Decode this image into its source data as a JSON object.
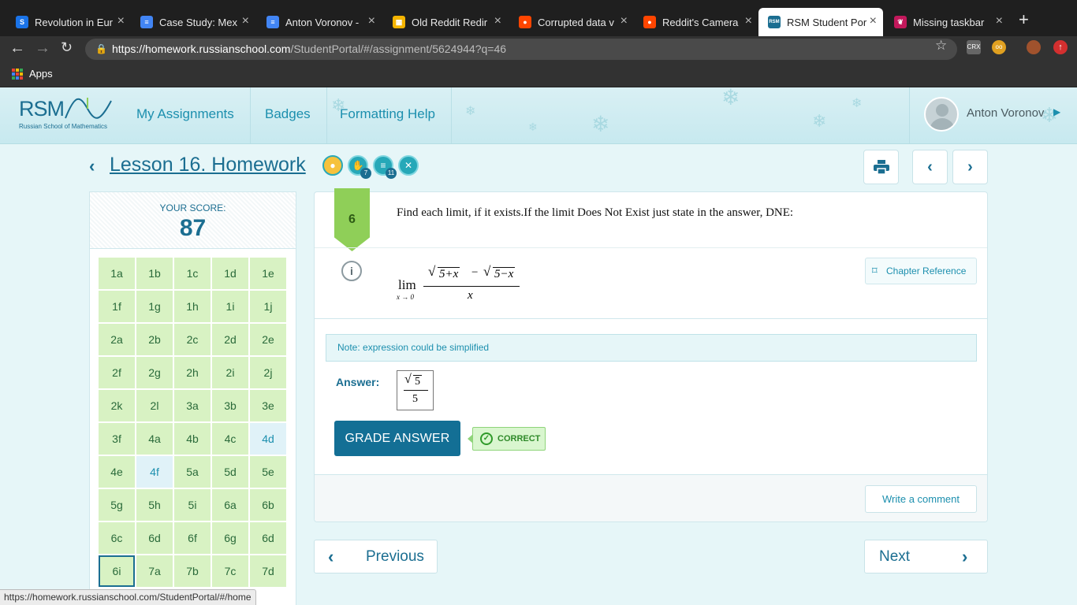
{
  "browser": {
    "tabs": [
      {
        "title": "Revolution in Eur",
        "favicon_color": "#1a73e8",
        "favicon_glyph": "S"
      },
      {
        "title": "Case Study: Mex",
        "favicon_color": "#4285f4",
        "favicon_glyph": "≡"
      },
      {
        "title": "Anton Voronov -",
        "favicon_color": "#4285f4",
        "favicon_glyph": "≡"
      },
      {
        "title": "Old Reddit Redir",
        "favicon_color": "#f4b400",
        "favicon_glyph": "▦"
      },
      {
        "title": "Corrupted data v",
        "favicon_color": "#ff4500",
        "favicon_glyph": "●"
      },
      {
        "title": "Reddit's Camera",
        "favicon_color": "#ff4500",
        "favicon_glyph": "●"
      },
      {
        "title": "RSM Student Por",
        "favicon_color": "#1b6e91",
        "favicon_glyph": "RSM"
      },
      {
        "title": "Missing taskbar",
        "favicon_color": "#c2185b",
        "favicon_glyph": "❦"
      }
    ],
    "active_tab_index": 6,
    "url_host": "https://homework.russianschool.com",
    "url_path": "/StudentPortal/#/assignment/5624944?q=46",
    "bookmarks_apps_label": "Apps",
    "extensions": [
      "CRX",
      "oo"
    ],
    "status_url": "https://homework.russianschool.com/StudentPortal/#/home"
  },
  "header": {
    "logo_text": "RSM",
    "logo_subtitle": "Russian School of Mathematics",
    "nav": [
      "My Assignments",
      "Badges",
      "Formatting Help"
    ],
    "user_name": "Anton Voronov"
  },
  "lesson": {
    "title": "Lesson 16. Homework",
    "badges": [
      {
        "icon": "medal-icon",
        "count": ""
      },
      {
        "icon": "hand-icon",
        "count": "7"
      },
      {
        "icon": "books-icon",
        "count": "11"
      },
      {
        "icon": "tools-icon",
        "count": ""
      }
    ]
  },
  "score": {
    "label": "YOUR SCORE:",
    "value": "87",
    "problems": [
      "1a",
      "1b",
      "1c",
      "1d",
      "1e",
      "1f",
      "1g",
      "1h",
      "1i",
      "1j",
      "2a",
      "2b",
      "2c",
      "2d",
      "2e",
      "2f",
      "2g",
      "2h",
      "2i",
      "2j",
      "2k",
      "2l",
      "3a",
      "3b",
      "3e",
      "3f",
      "4a",
      "4b",
      "4c",
      "4d",
      "4e",
      "4f",
      "5a",
      "5d",
      "5e",
      "5g",
      "5h",
      "5i",
      "6a",
      "6b",
      "6c",
      "6d",
      "6f",
      "6g",
      "6d",
      "6i",
      "7a",
      "7b",
      "7c",
      "7d"
    ],
    "blue_problems": [
      29,
      31
    ],
    "current_problem": 45
  },
  "question": {
    "number": "6",
    "text": "Find each limit, if it exists.If the limit Does Not Exist just state in the answer, DNE:",
    "formula": {
      "lim": "lim",
      "sub": "x → 0",
      "num_left": "5+x",
      "minus": "−",
      "num_right": "5−x",
      "den": "x"
    },
    "chapter_reference": "Chapter Reference",
    "note": "Note: expression could be simplified",
    "answer_label": "Answer:",
    "answer": {
      "num": "5",
      "den": "5"
    },
    "grade_button": "GRADE ANSWER",
    "result": "CORRECT",
    "comment_button": "Write a comment"
  },
  "pager": {
    "previous": "Previous",
    "next": "Next"
  }
}
